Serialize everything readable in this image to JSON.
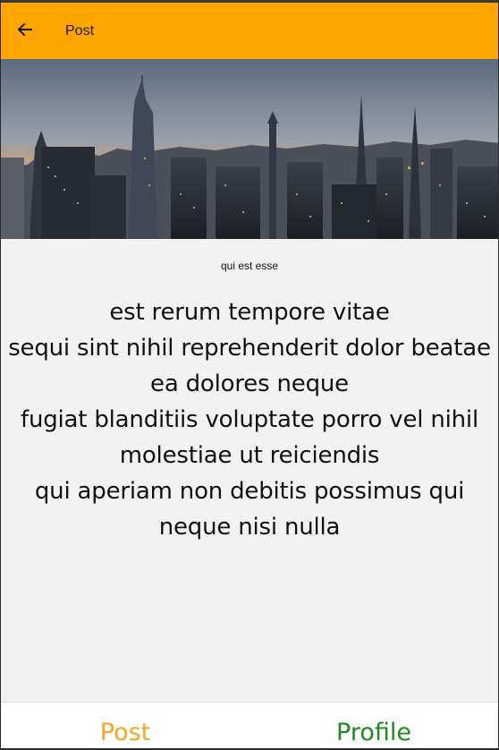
{
  "app_bar": {
    "title": "Post",
    "back_icon": "arrow-left-icon",
    "color": "#ffa500"
  },
  "hero_image": {
    "description_icon": "city-skyline-image"
  },
  "post": {
    "title": "qui est esse",
    "body": "est rerum tempore vitae\nsequi sint nihil reprehenderit dolor beatae\nea dolores neque\nfugiat blanditiis voluptate porro vel nihil\nmolestiae ut reiciendis\nqui aperiam non debitis possimus qui\nneque nisi nulla"
  },
  "bottom_nav": {
    "post_label": "Post",
    "profile_label": "Profile",
    "post_color": "#f5a623",
    "profile_color": "#1e8a1e"
  }
}
